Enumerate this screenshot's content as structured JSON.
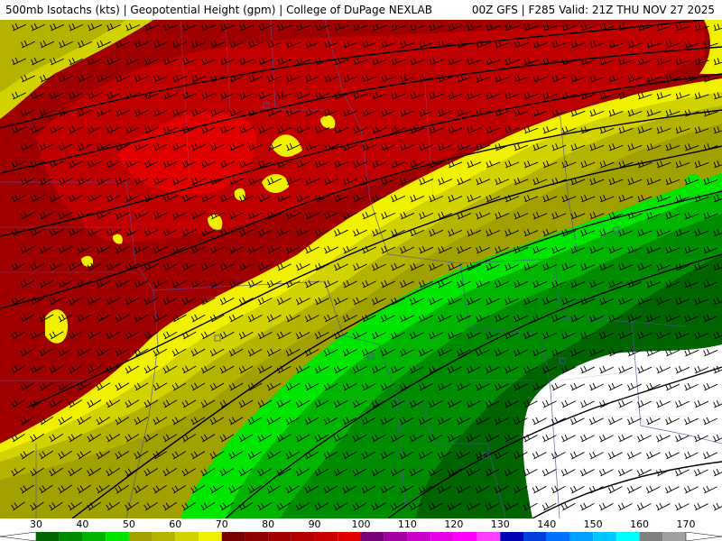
{
  "header": {
    "title": "500mb Isotachs (kts) | Geopotential Height (gpm) | College of DuPage NEXLAB",
    "run": "00Z GFS | F285 Valid: 21Z THU NOV 27 2025"
  },
  "legend": {
    "ticks": [
      "30",
      "40",
      "50",
      "60",
      "70",
      "80",
      "90",
      "100",
      "110",
      "120",
      "130",
      "140",
      "150",
      "160",
      "170"
    ],
    "tick_values": [
      30,
      40,
      50,
      60,
      70,
      80,
      90,
      100,
      110,
      120,
      130,
      140,
      150,
      160,
      170
    ],
    "bins": [
      {
        "from": 30,
        "to": 35,
        "color": "#006400"
      },
      {
        "from": 35,
        "to": 40,
        "color": "#008c00"
      },
      {
        "from": 40,
        "to": 45,
        "color": "#00b400"
      },
      {
        "from": 45,
        "to": 50,
        "color": "#00e600"
      },
      {
        "from": 50,
        "to": 55,
        "color": "#a0a000"
      },
      {
        "from": 55,
        "to": 60,
        "color": "#b4b400"
      },
      {
        "from": 60,
        "to": 65,
        "color": "#d2d200"
      },
      {
        "from": 65,
        "to": 70,
        "color": "#f0f000"
      },
      {
        "from": 70,
        "to": 75,
        "color": "#780000"
      },
      {
        "from": 75,
        "to": 80,
        "color": "#8c0000"
      },
      {
        "from": 80,
        "to": 85,
        "color": "#a00000"
      },
      {
        "from": 85,
        "to": 90,
        "color": "#b40000"
      },
      {
        "from": 90,
        "to": 95,
        "color": "#c80000"
      },
      {
        "from": 95,
        "to": 100,
        "color": "#e00000"
      },
      {
        "from": 100,
        "to": 105,
        "color": "#7a007a"
      },
      {
        "from": 105,
        "to": 110,
        "color": "#a000a0"
      },
      {
        "from": 110,
        "to": 115,
        "color": "#c800c8"
      },
      {
        "from": 115,
        "to": 120,
        "color": "#e600e6"
      },
      {
        "from": 120,
        "to": 125,
        "color": "#ff00ff"
      },
      {
        "from": 125,
        "to": 130,
        "color": "#ff40ff"
      },
      {
        "from": 130,
        "to": 135,
        "color": "#0000b4"
      },
      {
        "from": 135,
        "to": 140,
        "color": "#0040e0"
      },
      {
        "from": 140,
        "to": 145,
        "color": "#0070ff"
      },
      {
        "from": 145,
        "to": 150,
        "color": "#00a0ff"
      },
      {
        "from": 150,
        "to": 155,
        "color": "#00c8ff"
      },
      {
        "from": 155,
        "to": 160,
        "color": "#00ffff"
      },
      {
        "from": 160,
        "to": 165,
        "color": "#808080"
      },
      {
        "from": 165,
        "to": 170,
        "color": "#a0a0a0"
      }
    ],
    "low_color": "#ffffff"
  },
  "map": {
    "background_color": "#ffffff",
    "state_line_color": "#5050a0",
    "county_line_color": "#8080c8",
    "height_contour_color": "#000000",
    "barb_color": "#000000"
  }
}
